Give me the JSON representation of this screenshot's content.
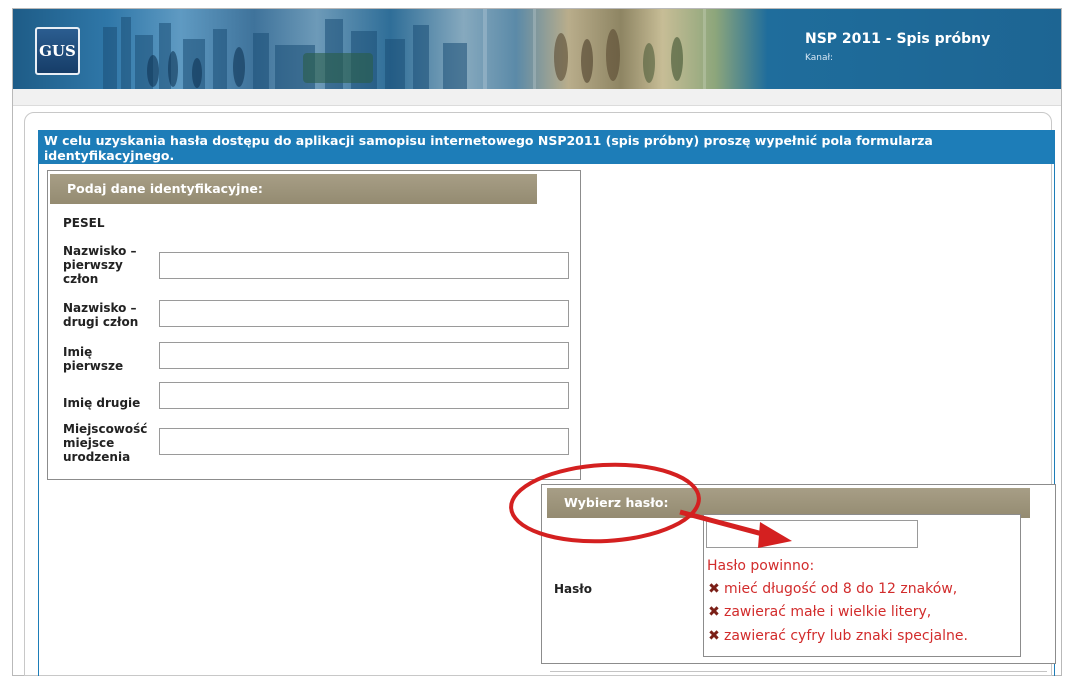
{
  "header": {
    "logo_text": "GUS",
    "title": "NSP 2011 - Spis próbny",
    "subtitle": "Kanał:"
  },
  "info_message": "W celu uzyskania hasła dostępu do aplikacji samopisu internetowego NSP2011 (spis próbny) proszę wypełnić pola formularza identyfikacyjnego.",
  "identification": {
    "title": "Podaj dane identyfikacyjne:",
    "pesel_label": "PESEL",
    "fields": [
      {
        "label": "Nazwisko – pierwszy człon",
        "value": ""
      },
      {
        "label": "Nazwisko – drugi człon",
        "value": ""
      },
      {
        "label": "Imię pierwsze",
        "value": ""
      },
      {
        "label": "Imię drugie",
        "value": ""
      },
      {
        "label": "Miejscowość miejsce urodzenia",
        "value": ""
      }
    ]
  },
  "password": {
    "title": "Wybierz hasło:",
    "label": "Hasło",
    "value": "",
    "requirements_intro": "Hasło powinno:",
    "requirements": [
      "mieć długość od 8 do 12 znaków,",
      "zawierać małe i wielkie litery,",
      "zawierać cyfry lub znaki specjalne."
    ],
    "requirement_icon": "cross-icon"
  },
  "colors": {
    "info_bar": "#1d7db8",
    "section_header": "#9d947a",
    "requirement_text": "#d22c2c",
    "annotation": "#d42020"
  }
}
